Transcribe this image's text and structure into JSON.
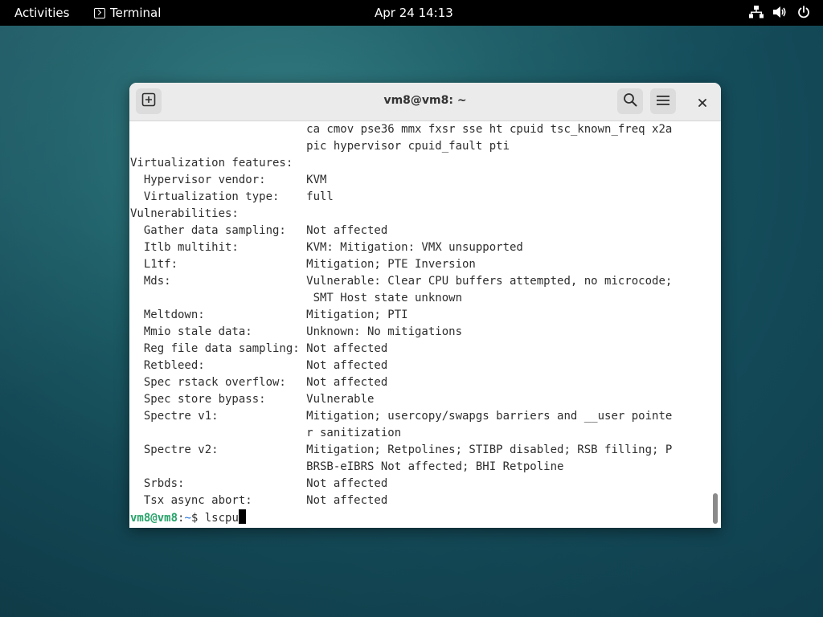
{
  "topbar": {
    "activities": "Activities",
    "app_name": "Terminal",
    "clock": "Apr 24  14:13"
  },
  "window": {
    "title": "vm8@vm8: ~"
  },
  "terminal": {
    "lines": [
      "                          ca cmov pse36 mmx fxsr sse ht cpuid tsc_known_freq x2a",
      "                          pic hypervisor cpuid_fault pti",
      "Virtualization features:",
      "  Hypervisor vendor:      KVM",
      "  Virtualization type:    full",
      "Vulnerabilities:",
      "  Gather data sampling:   Not affected",
      "  Itlb multihit:          KVM: Mitigation: VMX unsupported",
      "  L1tf:                   Mitigation; PTE Inversion",
      "  Mds:                    Vulnerable: Clear CPU buffers attempted, no microcode;",
      "                           SMT Host state unknown",
      "  Meltdown:               Mitigation; PTI",
      "  Mmio stale data:        Unknown: No mitigations",
      "  Reg file data sampling: Not affected",
      "  Retbleed:               Not affected",
      "  Spec rstack overflow:   Not affected",
      "  Spec store bypass:      Vulnerable",
      "  Spectre v1:             Mitigation; usercopy/swapgs barriers and __user pointe",
      "                          r sanitization",
      "  Spectre v2:             Mitigation; Retpolines; STIBP disabled; RSB filling; P",
      "                          BRSB-eIBRS Not affected; BHI Retpoline",
      "  Srbds:                  Not affected",
      "  Tsx async abort:        Not affected"
    ],
    "prompt_user": "vm8@vm8",
    "prompt_sep": ":",
    "prompt_path": "~",
    "prompt_symbol": "$ ",
    "command": "lscpu"
  },
  "icons": {
    "new_tab": "new-tab-icon",
    "search": "search-icon",
    "menu": "hamburger-menu-icon",
    "close": "close-icon",
    "network": "network-icon",
    "volume": "volume-icon",
    "power": "power-icon"
  },
  "colors": {
    "prompt_user": "#26a269",
    "prompt_path": "#1c71d8",
    "topbar_bg": "#000000",
    "headerbar_bg": "#ebebeb"
  }
}
